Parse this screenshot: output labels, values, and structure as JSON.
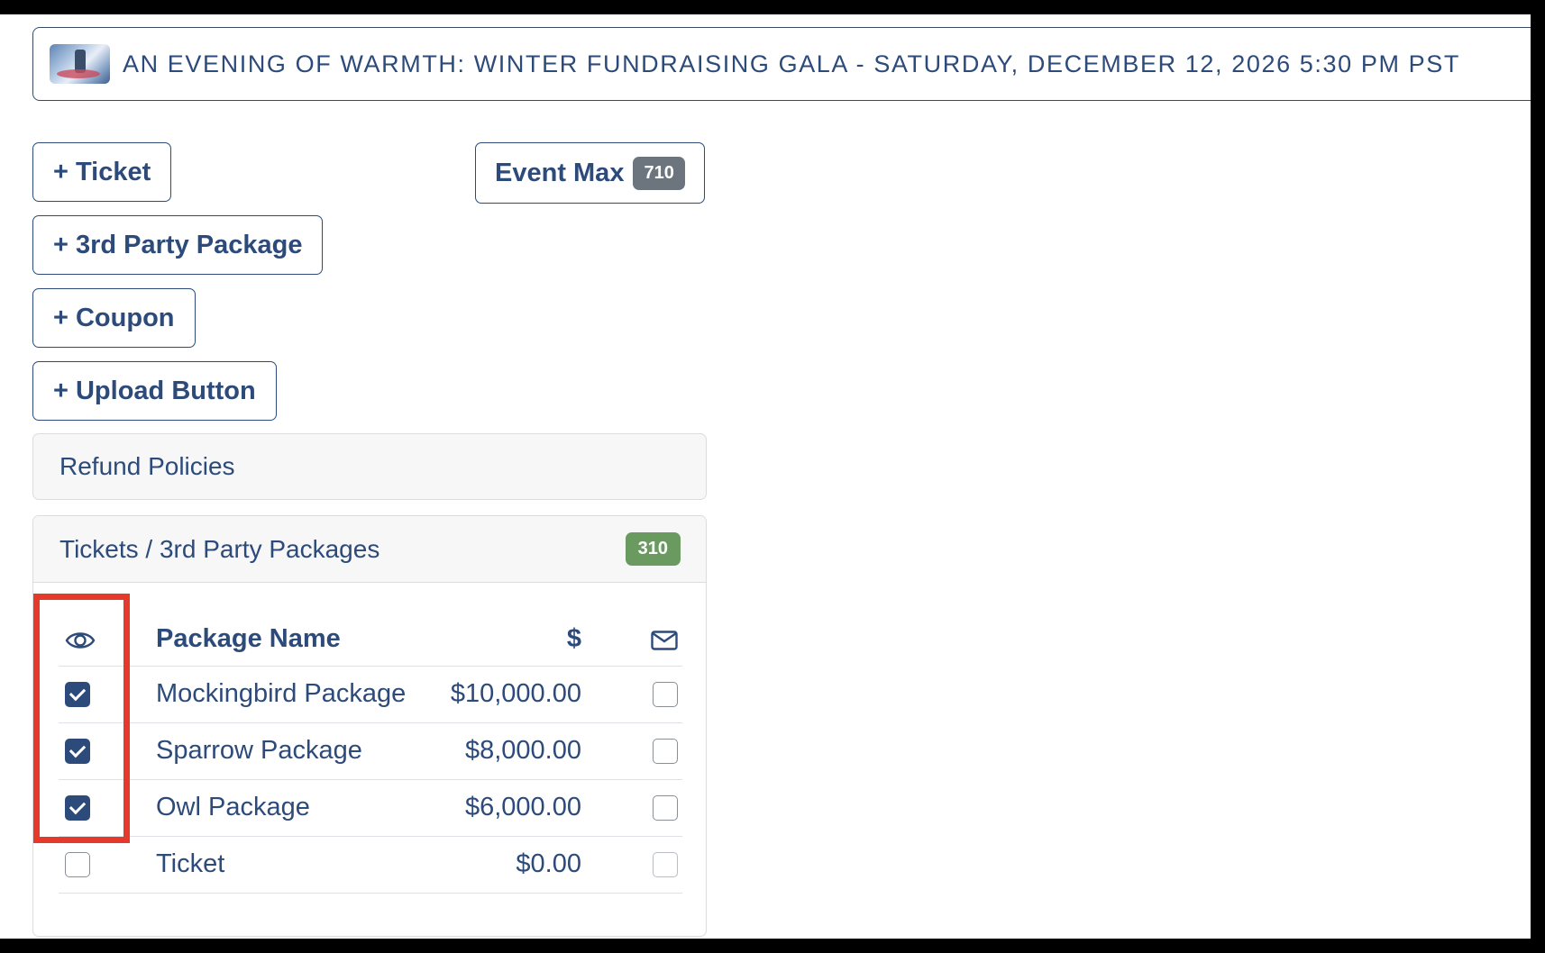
{
  "event": {
    "title": "AN EVENING OF WARMTH: WINTER FUNDRAISING GALA - SATURDAY, DECEMBER 12, 2026 5:30 PM PST",
    "thumbnail_icon": "event-thumbnail-image"
  },
  "actions": {
    "ticket": "+ Ticket",
    "third_party": "+ 3rd Party Package",
    "coupon": "+ Coupon",
    "upload": "+ Upload Button"
  },
  "event_max": {
    "label": "Event Max",
    "count": "710"
  },
  "refund_policies": {
    "label": "Refund Policies"
  },
  "tickets_section": {
    "title": "Tickets / 3rd Party Packages",
    "count": "310",
    "columns": {
      "visible_icon": "eye-icon",
      "name": "Package Name",
      "price": "$",
      "email_icon": "envelope-icon"
    },
    "rows": [
      {
        "name": "Mockingbird Package",
        "price": "$10,000.00",
        "visible": true,
        "email": false
      },
      {
        "name": "Sparrow Package",
        "price": "$8,000.00",
        "visible": true,
        "email": false
      },
      {
        "name": "Owl Package",
        "price": "$6,000.00",
        "visible": true,
        "email": false
      },
      {
        "name": "Ticket",
        "price": "$0.00",
        "visible": false,
        "email": false
      }
    ]
  },
  "colors": {
    "primary": "#2c4a7a",
    "highlight": "#e5392b",
    "badge_green": "#6a9a5f",
    "badge_gray": "#6c757d"
  }
}
